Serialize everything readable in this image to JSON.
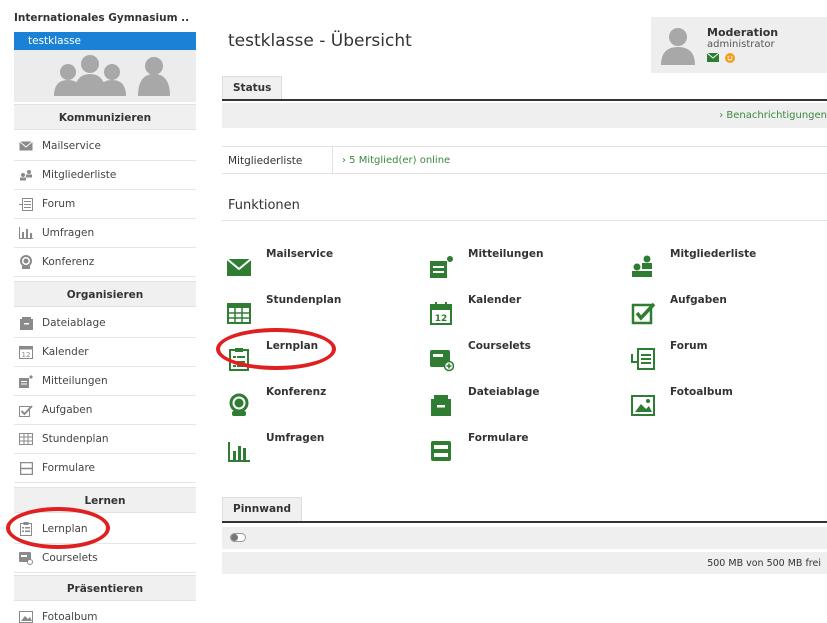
{
  "sidebar": {
    "school_name": "Internationales Gymnasium ..",
    "class_name": "testklasse",
    "sections": [
      {
        "title": "Kommunizieren"
      },
      {
        "title": "Organisieren"
      },
      {
        "title": "Lernen"
      },
      {
        "title": "Präsentieren"
      }
    ],
    "kommunizieren": [
      "Mailservice",
      "Mitgliederliste",
      "Forum",
      "Umfragen",
      "Konferenz"
    ],
    "organisieren": [
      "Dateiablage",
      "Kalender",
      "Mitteilungen",
      "Aufgaben",
      "Stundenplan",
      "Formulare"
    ],
    "lernen": [
      "Lernplan",
      "Courselets"
    ],
    "praesentieren": [
      "Fotoalbum"
    ]
  },
  "header": {
    "title": "testklasse - Übersicht",
    "moderation_title": "Moderation",
    "moderation_role": "administrator"
  },
  "status": {
    "tab_label": "Status",
    "benachrichtigungen": "› Benachrichtigungen",
    "mitgliederliste_label": "Mitgliederliste",
    "online_text": "› 5 Mitglied(er) online"
  },
  "funktionen": {
    "title": "Funktionen",
    "items": [
      "Mailservice",
      "Mitteilungen",
      "Mitgliederliste",
      "Stundenplan",
      "Kalender",
      "Aufgaben",
      "Lernplan",
      "Courselets",
      "Forum",
      "Konferenz",
      "Dateiablage",
      "Fotoalbum",
      "Umfragen",
      "Formulare"
    ]
  },
  "pinnwand": {
    "tab_label": "Pinnwand",
    "storage_text": "500 MB von 500 MB frei"
  },
  "colors": {
    "accent_blue": "#1a82d6",
    "icon_green": "#2e7d32",
    "link_green": "#3a8a3a",
    "highlight_red": "#e02020"
  }
}
